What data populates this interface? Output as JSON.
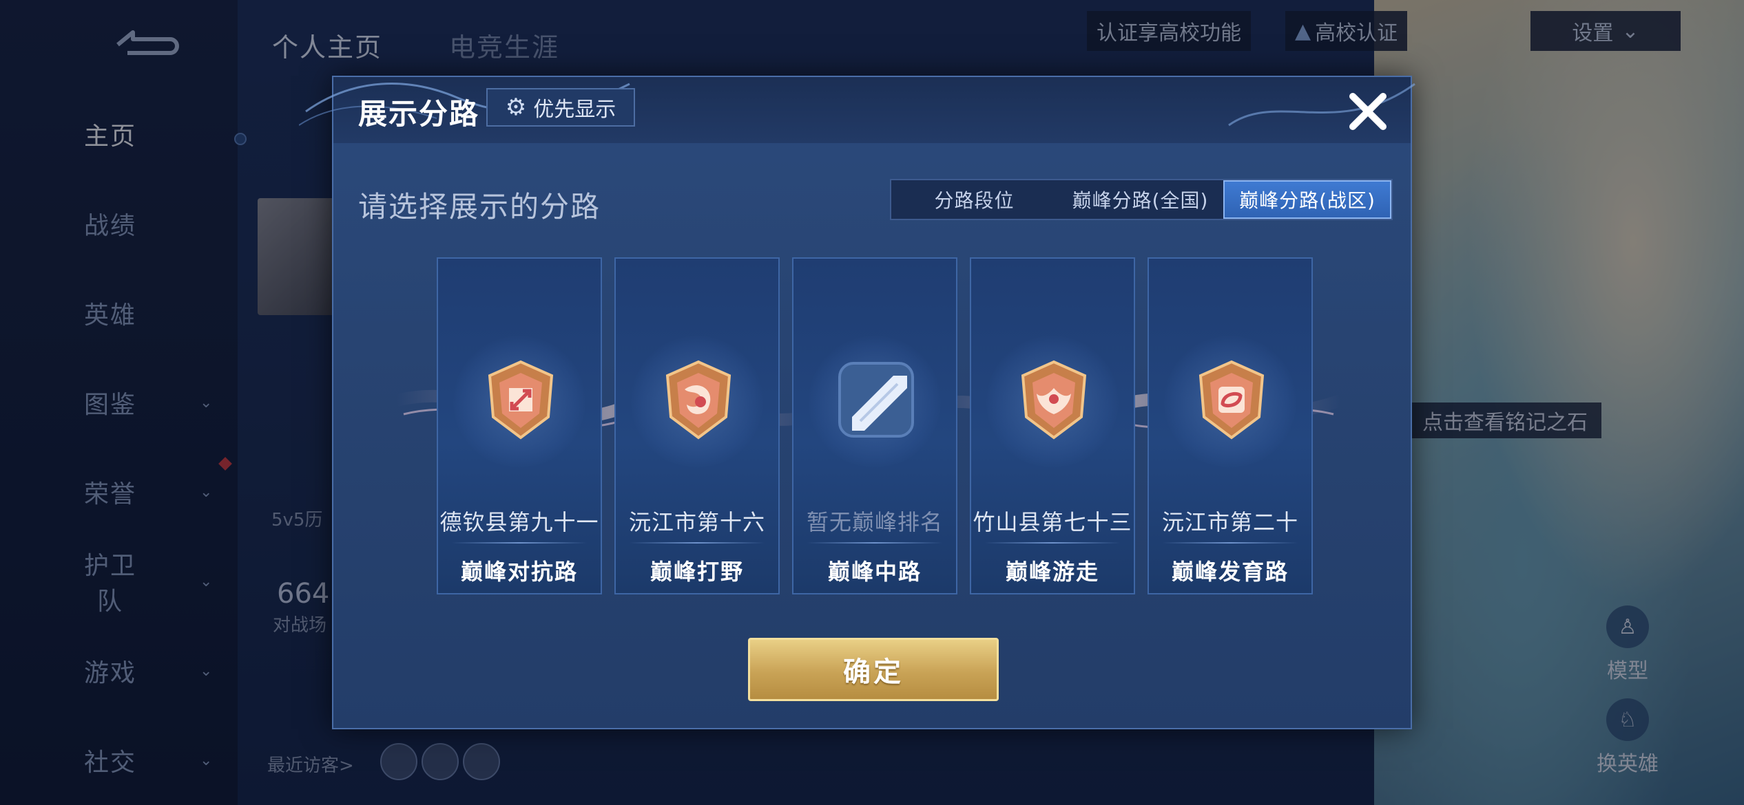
{
  "sidebar": {
    "items": [
      {
        "label": "主页",
        "chevron": false,
        "active": true
      },
      {
        "label": "战绩",
        "chevron": false,
        "active": false
      },
      {
        "label": "英雄",
        "chevron": false,
        "active": false
      },
      {
        "label": "图鉴",
        "chevron": true,
        "active": false
      },
      {
        "label": "荣誉",
        "chevron": true,
        "active": false
      },
      {
        "label": "护卫队",
        "chevron": true,
        "active": false
      },
      {
        "label": "游戏",
        "chevron": true,
        "active": false
      },
      {
        "label": "社交",
        "chevron": true,
        "active": false
      }
    ]
  },
  "header": {
    "tabs": [
      "个人主页",
      "电竞生涯"
    ],
    "campus_tip": "认证享高校功能",
    "campus_cert": "高校认证",
    "settings": "设置"
  },
  "profile_bg": {
    "history_label": "5v5历",
    "match_count": "664",
    "match_label": "对战场",
    "recent_visitors": "最近访客>"
  },
  "right_panel": {
    "inscription_tip": "点击查看铭记之石",
    "model_label": "模型",
    "switch_hero_label": "换英雄"
  },
  "modal": {
    "title": "展示分路",
    "priority_button": "优先显示",
    "subtitle": "请选择展示的分路",
    "segments": [
      "分路段位",
      "巅峰分路(全国)",
      "巅峰分路(战区)"
    ],
    "selected_segment": "巅峰分路(战区)",
    "cards": [
      {
        "rank": "德钦县第九十一",
        "role": "巅峰对抗路",
        "icon": "clash-lane-emblem-icon",
        "has_rank": true
      },
      {
        "rank": "沅江市第十六",
        "role": "巅峰打野",
        "icon": "jungle-emblem-icon",
        "has_rank": true
      },
      {
        "rank": "暂无巅峰排名",
        "role": "巅峰中路",
        "icon": "mid-lane-empty-icon",
        "has_rank": false
      },
      {
        "rank": "竹山县第七十三",
        "role": "巅峰游走",
        "icon": "roam-emblem-icon",
        "has_rank": true
      },
      {
        "rank": "沅江市第二十",
        "role": "巅峰发育路",
        "icon": "farm-lane-emblem-icon",
        "has_rank": true
      }
    ],
    "confirm_button": "确定"
  },
  "colors": {
    "accent_blue": "#2f63b4",
    "gold": "#c9a356",
    "modal_bg": "#284472"
  }
}
